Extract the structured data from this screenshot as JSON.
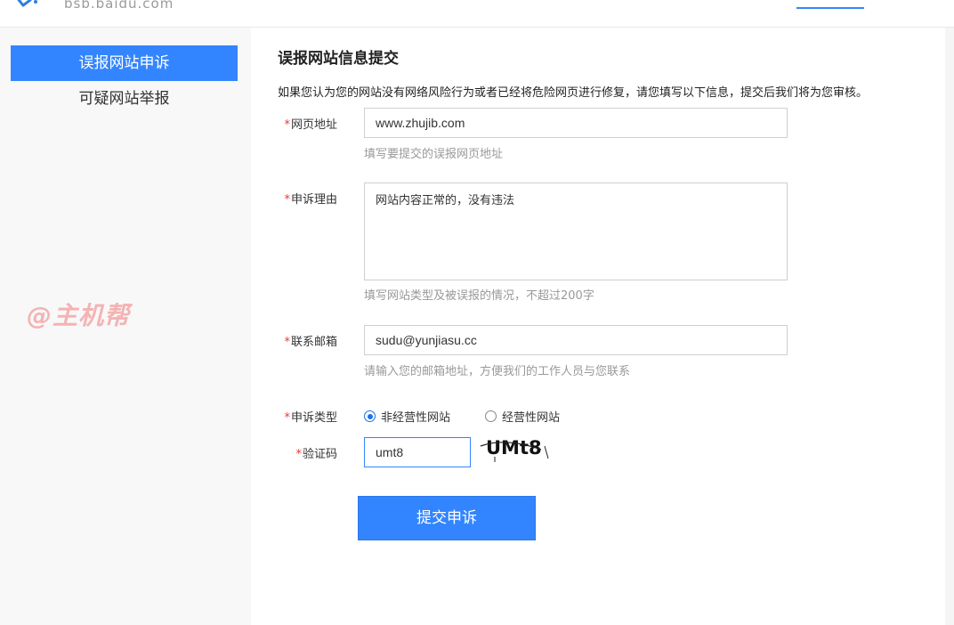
{
  "header": {
    "site_url": "bsb.baidu.com",
    "logo_icon": "baidu-safety-logo-icon"
  },
  "sidebar": {
    "items": [
      {
        "label": "误报网站申诉",
        "active": true
      },
      {
        "label": "可疑网站举报",
        "active": false
      }
    ],
    "watermark": "@主机帮"
  },
  "form": {
    "title": "误报网站信息提交",
    "intro": "如果您认为您的网站没有网络风险行为或者已经将危险网页进行修复，请您填写以下信息，提交后我们将为您审核。",
    "required_mark": "*",
    "url": {
      "label": "网页地址",
      "value": "www.zhujib.com",
      "hint": "填写要提交的误报网页地址"
    },
    "reason": {
      "label": "申诉理由",
      "value": "网站内容正常的，没有违法",
      "hint": "填写网站类型及被误报的情况，不超过200字"
    },
    "email": {
      "label": "联系邮箱",
      "value": "sudu@yunjiasu.cc",
      "hint": "请输入您的邮箱地址，方便我们的工作人员与您联系"
    },
    "type": {
      "label": "申诉类型",
      "options": [
        {
          "label": "非经营性网站",
          "checked": true
        },
        {
          "label": "经营性网站",
          "checked": false
        }
      ]
    },
    "captcha": {
      "label": "验证码",
      "value": "umt8",
      "image_text": "UMt8"
    },
    "submit_label": "提交申诉"
  },
  "colors": {
    "accent": "#3385ff",
    "required": "#e53935",
    "hint": "#999999"
  }
}
